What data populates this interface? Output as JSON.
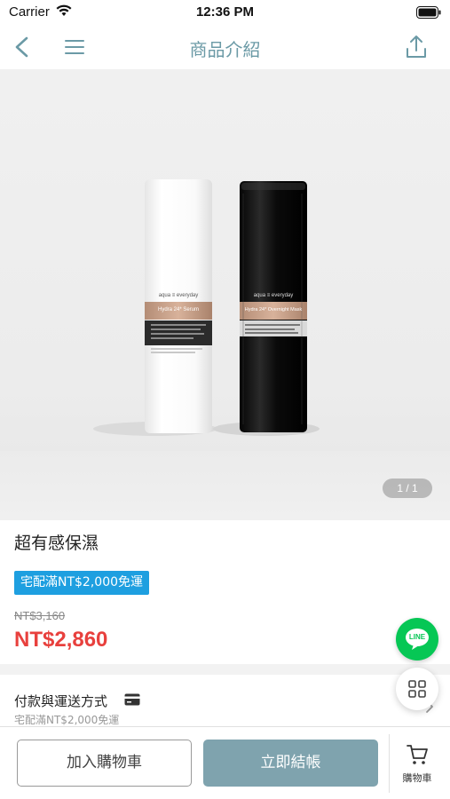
{
  "status_bar": {
    "carrier": "Carrier",
    "time": "12:36 PM"
  },
  "nav": {
    "title": "商品介紹"
  },
  "gallery": {
    "indicator": "1 / 1",
    "bottle_brand": "aqua ≡ everyday",
    "bottle_left_label": "Hydra 24* Serum",
    "bottle_right_label": "Hydra 24* Overnight Mask"
  },
  "product": {
    "name": "超有感保濕",
    "shipping_badge": "宅配滿NT$2,000免運",
    "original_price": "NT$3,160",
    "price": "NT$2,860"
  },
  "payment": {
    "title": "付款與運送方式",
    "subtitle": "宅配滿NT$2,000免運"
  },
  "bottom_bar": {
    "add_to_cart": "加入購物車",
    "checkout": "立即結帳",
    "cart_label": "購物車"
  },
  "floating": {
    "line_label": "LINE"
  },
  "colors": {
    "accent": "#6b9aa6",
    "checkout": "#7fa3ae",
    "price": "#e8403d",
    "badge": "#1e9fe0",
    "line_green": "#06c755"
  }
}
